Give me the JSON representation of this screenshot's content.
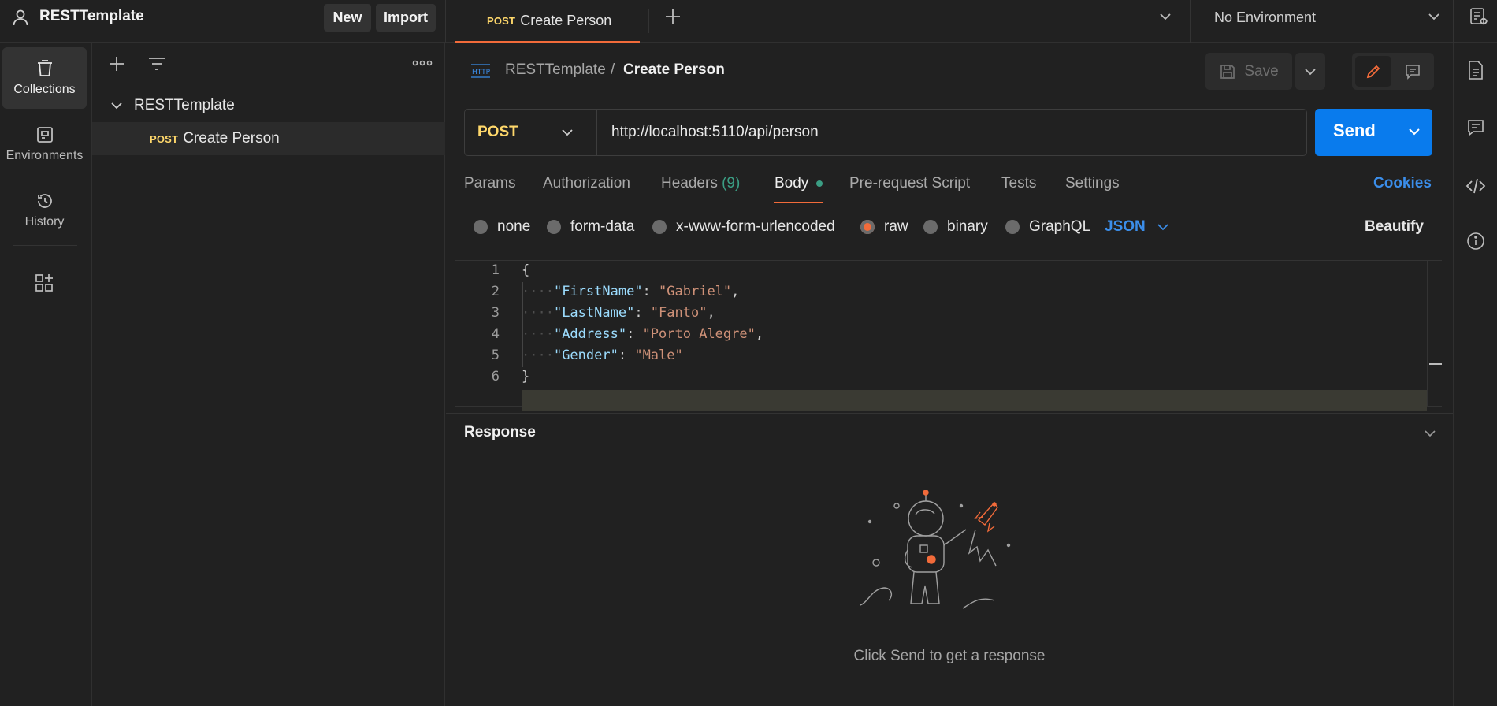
{
  "workspace": {
    "title": "RESTTemplate",
    "new_label": "New",
    "import_label": "Import"
  },
  "tabs": [
    {
      "method": "POST",
      "label": "Create Person"
    }
  ],
  "environment": {
    "selected": "No Environment"
  },
  "rail": {
    "items": [
      {
        "label": "Collections",
        "icon": "collections-icon"
      },
      {
        "label": "Environments",
        "icon": "environments-icon"
      },
      {
        "label": "History",
        "icon": "history-icon"
      }
    ]
  },
  "sidebar": {
    "collection": "RESTTemplate",
    "request": {
      "method": "POST",
      "label": "Create Person"
    }
  },
  "breadcrumb": {
    "collection": "RESTTemplate",
    "separator": "/",
    "request": "Create Person"
  },
  "save_label": "Save",
  "request": {
    "method": "POST",
    "url": "http://localhost:5110/api/person",
    "send_label": "Send"
  },
  "request_tabs": {
    "params": "Params",
    "authorization": "Authorization",
    "headers": "Headers",
    "headers_count": "(9)",
    "body": "Body",
    "prerequest": "Pre-request Script",
    "tests": "Tests",
    "settings": "Settings",
    "cookies": "Cookies"
  },
  "body_types": {
    "none": "none",
    "form_data": "form-data",
    "urlencoded": "x-www-form-urlencoded",
    "raw": "raw",
    "binary": "binary",
    "graphql": "GraphQL",
    "language": "JSON",
    "beautify": "Beautify",
    "selected": "raw"
  },
  "editor": {
    "line_numbers": [
      "1",
      "2",
      "3",
      "4",
      "5",
      "6"
    ],
    "open_brace": "{",
    "close_brace": "}",
    "fields": [
      {
        "key": "\"FirstName\"",
        "value": "\"Gabriel\"",
        "comma": ","
      },
      {
        "key": "\"LastName\"",
        "value": "\"Fanto\"",
        "comma": ","
      },
      {
        "key": "\"Address\"",
        "value": "\"Porto Alegre\"",
        "comma": ","
      },
      {
        "key": "\"Gender\"",
        "value": "\"Male\"",
        "comma": ""
      }
    ]
  },
  "response": {
    "title": "Response",
    "empty_message": "Click Send to get a response"
  },
  "colors": {
    "accent": "#f26b3a",
    "send": "#097bed",
    "post": "#ffd86b",
    "link": "#3b8eea"
  }
}
